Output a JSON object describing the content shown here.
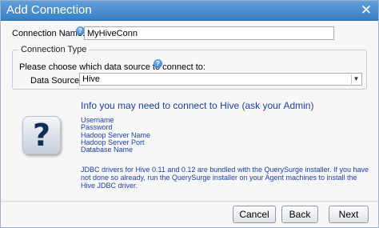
{
  "dialog": {
    "title": "Add Connection",
    "close_glyph": "✕"
  },
  "connection": {
    "name_label": "Connection Name:",
    "name_value": "MyHiveConn"
  },
  "connection_type": {
    "legend": "Connection Type",
    "choose_label": "Please choose which data source to connect to:",
    "data_source_label": "Data Source:",
    "required_mark": "*",
    "data_source_value": "Hive"
  },
  "info": {
    "title": "Info you may need to connect to Hive (ask your Admin)",
    "items": [
      "Username",
      "Password",
      "Hadoop Server Name",
      "Hadoop Server Port",
      "Database Name"
    ],
    "text": "JDBC drivers for Hive 0.11 and 0.12 are bundled with the QuerySurge installer. If you have not done so already, run the QuerySurge installer on your Agent machines to install the Hive JDBC driver."
  },
  "buttons": {
    "cancel": "Cancel",
    "back": "Back",
    "next": "Next"
  },
  "icons": {
    "help": "help-icon",
    "question": "question-mark-icon",
    "close": "close-icon",
    "dropdown": "chevron-down-icon"
  },
  "colors": {
    "title_bar": "#3b7fc4",
    "info_text": "#1e3fa0",
    "required": "#d40000"
  }
}
